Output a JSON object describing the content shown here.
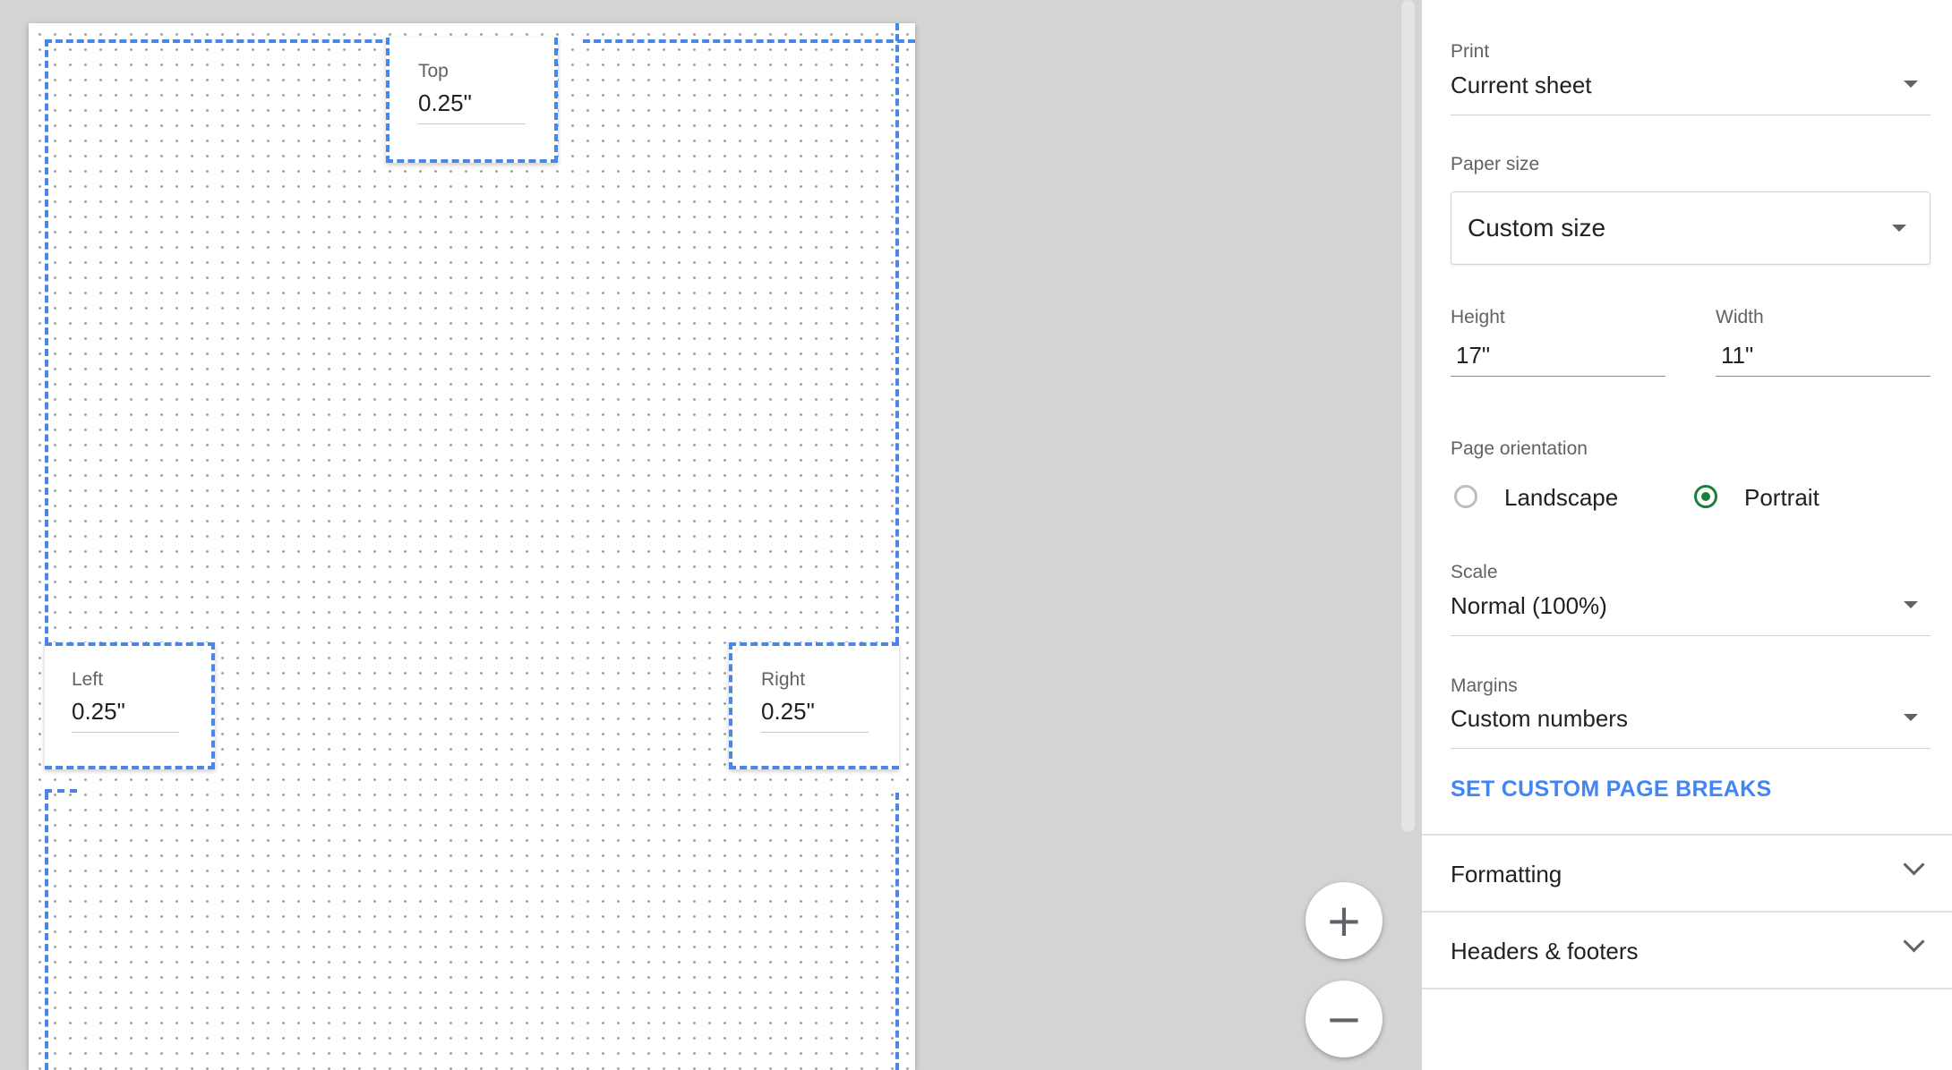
{
  "margins": {
    "top": {
      "label": "Top",
      "value": "0.25\""
    },
    "left": {
      "label": "Left",
      "value": "0.25\""
    },
    "right": {
      "label": "Right",
      "value": "0.25\""
    }
  },
  "zoom": {
    "in_symbol": "+",
    "out_symbol": "−"
  },
  "settings": {
    "print": {
      "label": "Print",
      "value": "Current sheet"
    },
    "paper_size": {
      "label": "Paper size",
      "value": "Custom size"
    },
    "height": {
      "label": "Height",
      "value": "17\""
    },
    "width": {
      "label": "Width",
      "value": "11\""
    },
    "orientation": {
      "label": "Page orientation",
      "options": [
        "Landscape",
        "Portrait"
      ],
      "selected": "Portrait"
    },
    "scale": {
      "label": "Scale",
      "value": "Normal (100%)"
    },
    "margins": {
      "label": "Margins",
      "value": "Custom numbers"
    },
    "custom_breaks": "SET CUSTOM PAGE BREAKS",
    "sections": [
      "Formatting",
      "Headers & footers"
    ]
  },
  "colors": {
    "accent_blue": "#4a86e8",
    "radio_green": "#188038",
    "link_blue": "#4285f4"
  }
}
